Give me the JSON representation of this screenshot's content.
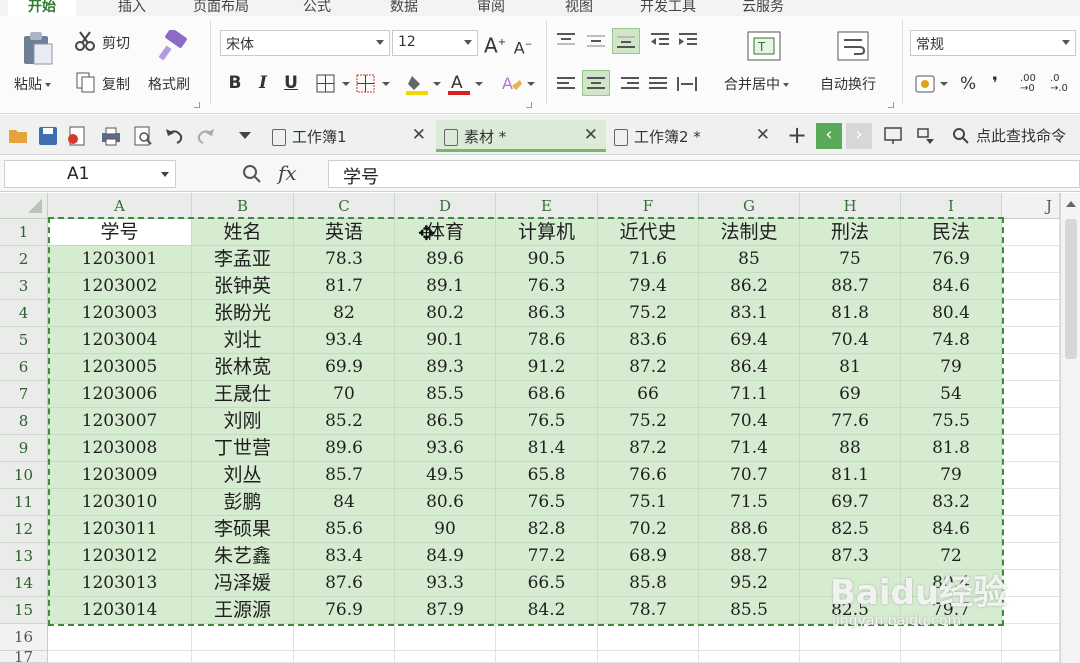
{
  "ribbon_tabs": [
    "开始",
    "插入",
    "页面布局",
    "公式",
    "数据",
    "审阅",
    "视图",
    "开发工具",
    "云服务"
  ],
  "ribbon": {
    "paste_label": "粘贴",
    "cut_label": "剪切",
    "copy_label": "复制",
    "format_painter_label": "格式刷",
    "font_name": "宋体",
    "font_size": "12",
    "bold": "B",
    "italic": "I",
    "underline": "U",
    "merge_center_label": "合并居中",
    "wrap_text_label": "自动换行",
    "number_format": "常规",
    "percent_symbol": "%",
    "comma_symbol": "❜",
    "decimal_increase": ".00",
    "decimal_decrease": ".0"
  },
  "document_tabs": [
    {
      "label": "工作簿1",
      "active": false
    },
    {
      "label": "素材 *",
      "active": true
    },
    {
      "label": "工作簿2 *",
      "active": false
    }
  ],
  "search_command_label": "点此查找命令",
  "formula_bar": {
    "name_box": "A1",
    "fx_label": "fx",
    "content": "学号"
  },
  "columns": [
    "A",
    "B",
    "C",
    "D",
    "E",
    "F",
    "G",
    "H",
    "I"
  ],
  "extra_column": "J",
  "row_numbers": [
    "1",
    "2",
    "3",
    "4",
    "5",
    "6",
    "7",
    "8",
    "9",
    "10",
    "11",
    "12",
    "13",
    "14",
    "15",
    "16",
    "17"
  ],
  "sheet": {
    "headers": [
      "学号",
      "姓名",
      "英语",
      "体育",
      "计算机",
      "近代史",
      "法制史",
      "刑法",
      "民法"
    ],
    "rows": [
      [
        "1203001",
        "李孟亚",
        "78.3",
        "89.6",
        "90.5",
        "71.6",
        "85",
        "75",
        "76.9"
      ],
      [
        "1203002",
        "张钟英",
        "81.7",
        "89.1",
        "76.3",
        "79.4",
        "86.2",
        "88.7",
        "84.6"
      ],
      [
        "1203003",
        "张盼光",
        "82",
        "80.2",
        "86.3",
        "75.2",
        "83.1",
        "81.8",
        "80.4"
      ],
      [
        "1203004",
        "刘壮",
        "93.4",
        "90.1",
        "78.6",
        "83.6",
        "69.4",
        "70.4",
        "74.8"
      ],
      [
        "1203005",
        "张林宽",
        "69.9",
        "89.3",
        "91.2",
        "87.2",
        "86.4",
        "81",
        "79"
      ],
      [
        "1203006",
        "王晟仕",
        "70",
        "85.5",
        "68.6",
        "66",
        "71.1",
        "69",
        "54"
      ],
      [
        "1203007",
        "刘刚",
        "85.2",
        "86.5",
        "76.5",
        "75.2",
        "70.4",
        "77.6",
        "75.5"
      ],
      [
        "1203008",
        "丁世营",
        "89.6",
        "93.6",
        "81.4",
        "87.2",
        "71.4",
        "88",
        "81.8"
      ],
      [
        "1203009",
        "刘丛",
        "85.7",
        "49.5",
        "65.8",
        "76.6",
        "70.7",
        "81.1",
        "79"
      ],
      [
        "1203010",
        "彭鹏",
        "84",
        "80.6",
        "76.5",
        "75.1",
        "71.5",
        "69.7",
        "83.2"
      ],
      [
        "1203011",
        "李硕果",
        "85.6",
        "90",
        "82.8",
        "70.2",
        "88.6",
        "82.5",
        "84.6"
      ],
      [
        "1203012",
        "朱艺鑫",
        "83.4",
        "84.9",
        "77.2",
        "68.9",
        "88.7",
        "87.3",
        "72"
      ],
      [
        "1203013",
        "冯泽媛",
        "87.6",
        "93.3",
        "66.5",
        "85.8",
        "95.2",
        "",
        "80.4"
      ],
      [
        "1203014",
        "王源源",
        "76.9",
        "87.9",
        "84.2",
        "78.7",
        "85.5",
        "82.5",
        "79.7"
      ]
    ]
  },
  "watermark": {
    "brand": "Baidu经验",
    "url": "jingyan.baidu.com"
  },
  "colors": {
    "selection_fill": "#d6ecd1",
    "accent_green": "#3c8c3c"
  }
}
